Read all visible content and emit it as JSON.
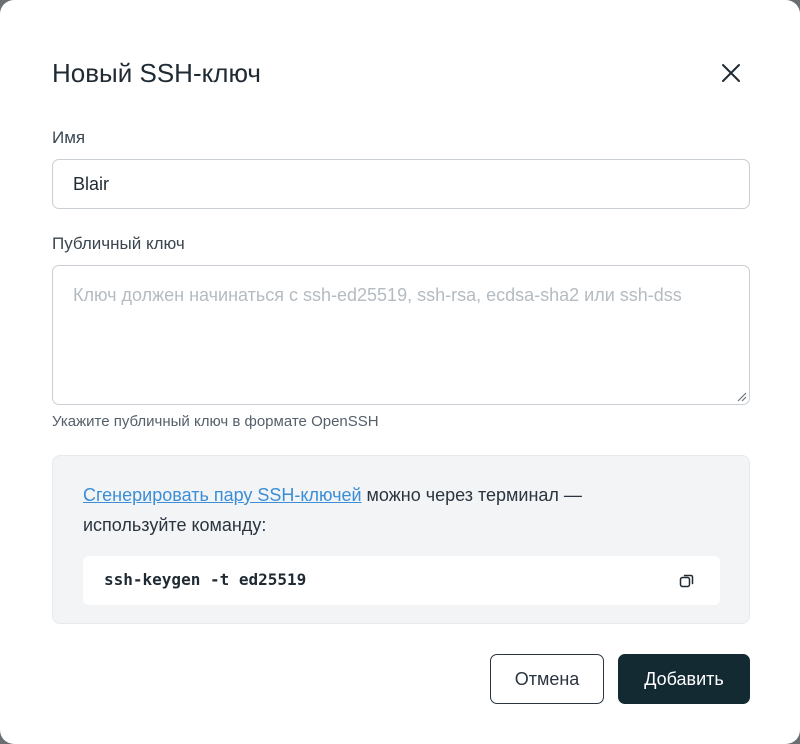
{
  "dialog": {
    "title": "Новый SSH-ключ",
    "close_icon": "close-icon"
  },
  "name_field": {
    "label": "Имя",
    "value": "Blair"
  },
  "key_field": {
    "label": "Публичный ключ",
    "placeholder": "Ключ должен начинаться с ssh-ed25519, ssh-rsa, ecdsa-sha2 или ssh-dss",
    "value": "",
    "hint": "Укажите публичный ключ в формате OpenSSH"
  },
  "info": {
    "link_text": "Сгенерировать пару SSH-ключей",
    "text_after_link": " можно через терминал — используйте команду:",
    "command": "ssh-keygen -t ed25519",
    "copy_icon": "copy-icon"
  },
  "actions": {
    "cancel_label": "Отмена",
    "add_label": "Добавить"
  },
  "colors": {
    "primary_button": "#142a33",
    "link": "#3b8ed6",
    "info_background": "#f3f4f6"
  }
}
